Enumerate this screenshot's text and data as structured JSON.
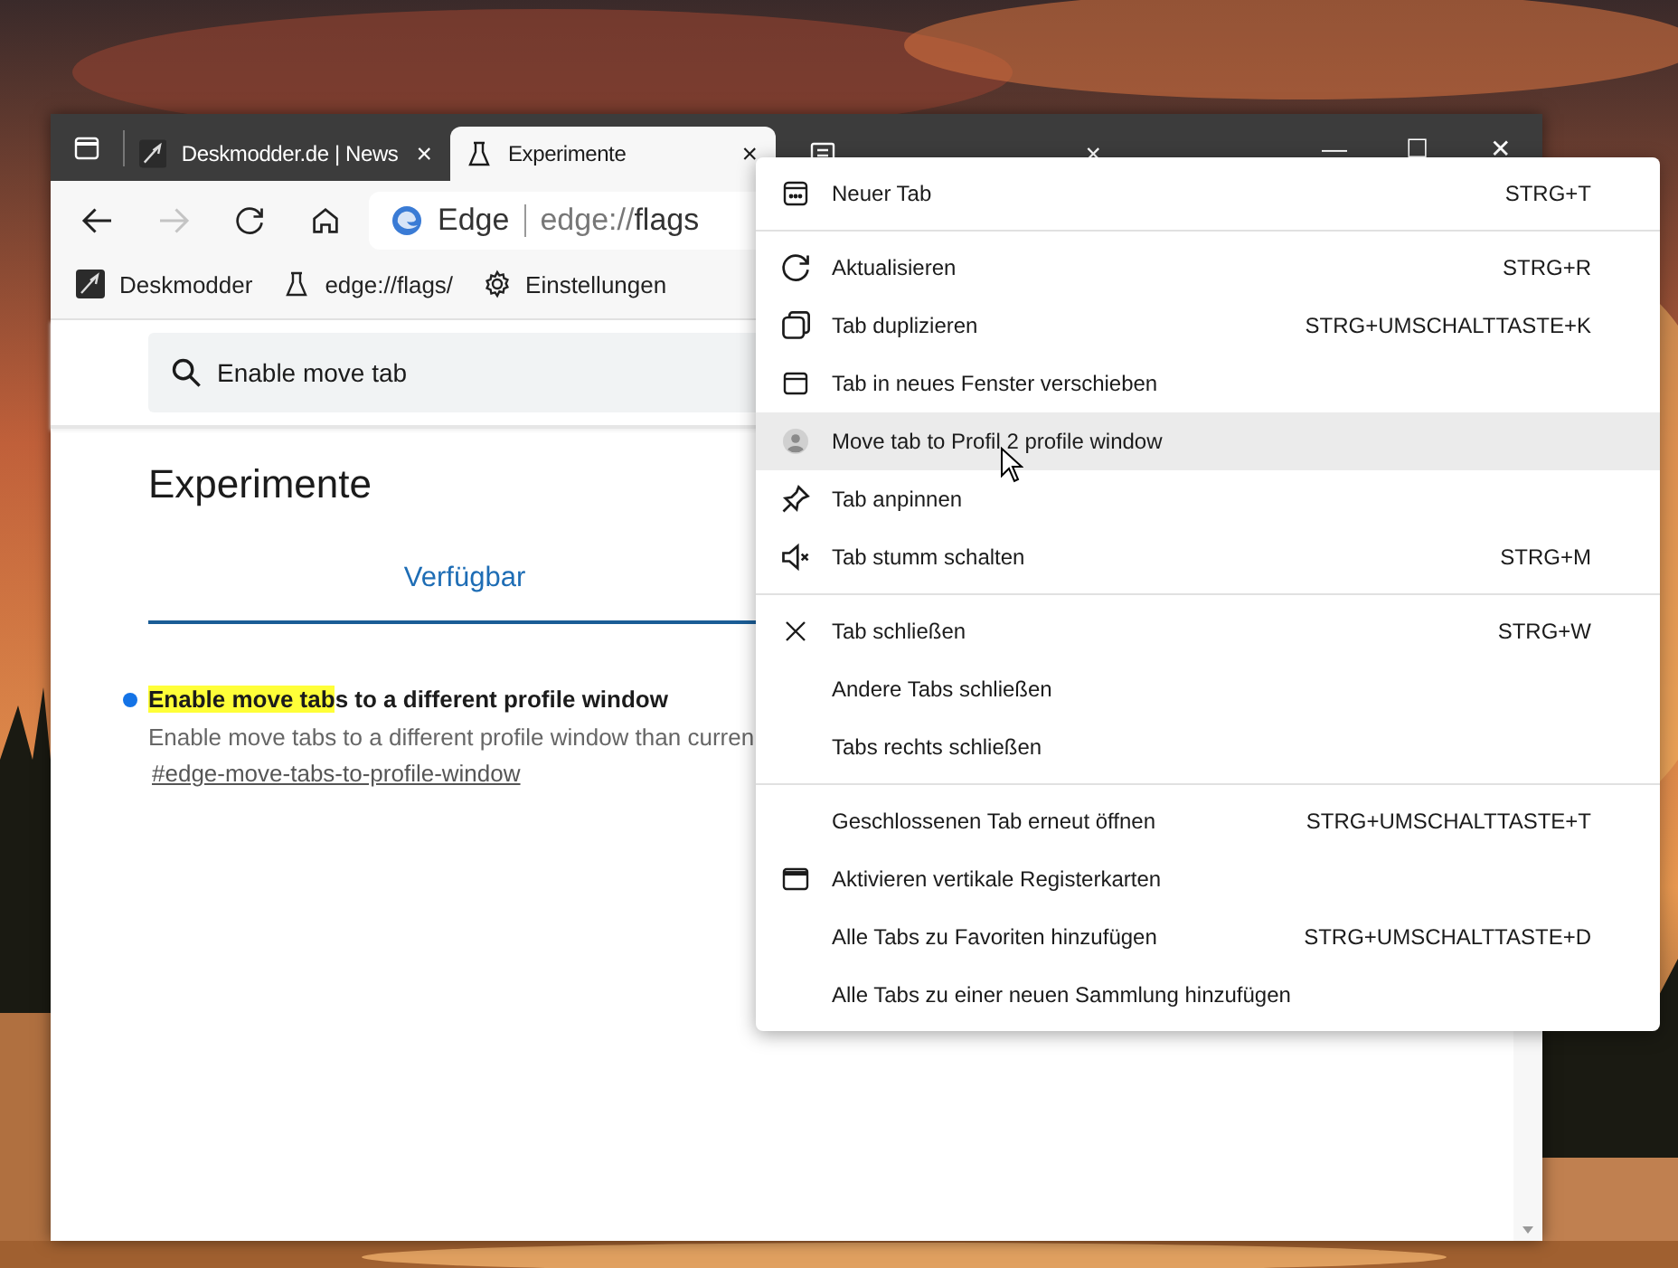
{
  "tabs": [
    {
      "title": "Deskmodder.de | News",
      "close": "×",
      "selected": false
    },
    {
      "title": "Experimente",
      "close": "×",
      "selected": true
    },
    {
      "close": "×",
      "selected": false
    }
  ],
  "window_controls": {
    "minimize": "—",
    "maximize": "☐",
    "close": "✕"
  },
  "address_bar": {
    "site": "Edge",
    "url_scheme": "edge://",
    "url_path": "flags"
  },
  "favorites": [
    {
      "label": "Deskmodder"
    },
    {
      "label": "edge://flags/"
    },
    {
      "label": "Einstellungen"
    }
  ],
  "flags_page": {
    "search": {
      "value": "Enable move tab"
    },
    "heading": "Experimente",
    "page_tabs": [
      {
        "label": "Verfügbar",
        "selected": true
      }
    ],
    "flags": [
      {
        "title_match": "Enable move tab",
        "title_rest": "s to a different profile window",
        "description": "Enable move tabs to a different profile window than curren",
        "link": "#edge-move-tabs-to-profile-window"
      }
    ]
  },
  "context_menu": {
    "groups": [
      {
        "items": [
          {
            "label": "Neuer Tab",
            "shortcut": "STRG+T",
            "selected": false
          }
        ]
      },
      {
        "items": [
          {
            "label": "Aktualisieren",
            "shortcut": "STRG+R",
            "selected": false
          },
          {
            "label": "Tab duplizieren",
            "shortcut": "STRG+UMSCHALTTASTE+K",
            "selected": false
          },
          {
            "label": "Tab in neues Fenster verschieben",
            "selected": false
          },
          {
            "label": "Move tab to Profil 2 profile window",
            "selected": true
          },
          {
            "label": "Tab anpinnen",
            "selected": false
          },
          {
            "label": "Tab stumm schalten",
            "shortcut": "STRG+M",
            "selected": false
          }
        ]
      },
      {
        "items": [
          {
            "label": "Tab schließen",
            "shortcut": "STRG+W",
            "selected": false
          },
          {
            "label": "Andere Tabs schließen",
            "selected": false
          },
          {
            "label": "Tabs rechts schließen",
            "selected": false
          }
        ]
      },
      {
        "items": [
          {
            "label": "Geschlossenen Tab erneut öffnen",
            "shortcut": "STRG+UMSCHALTTASTE+T",
            "selected": false
          },
          {
            "label": "Aktivieren vertikale Registerkarten",
            "selected": false
          },
          {
            "label": "Alle Tabs zu Favoriten hinzufügen",
            "shortcut": "STRG+UMSCHALTTASTE+D",
            "selected": false
          },
          {
            "label": "Alle Tabs zu einer neuen Sammlung hinzufügen",
            "selected": false
          }
        ]
      }
    ]
  }
}
